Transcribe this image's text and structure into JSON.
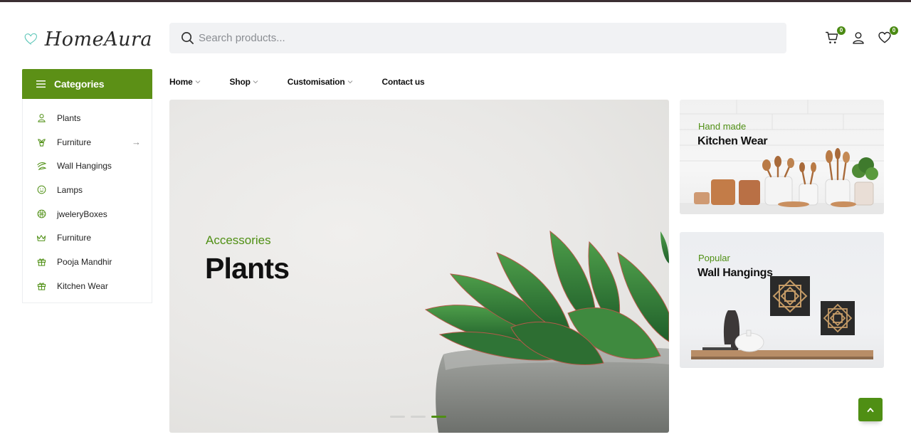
{
  "header": {
    "logo_text": "HomeAura",
    "search_placeholder": "Search products...",
    "cart_count": "0",
    "wishlist_count": "0"
  },
  "categories": {
    "title": "Categories",
    "items": [
      {
        "label": "Plants",
        "icon": "person-icon"
      },
      {
        "label": "Furniture",
        "icon": "plant-pot-icon",
        "has_submenu": true
      },
      {
        "label": "Wall Hangings",
        "icon": "leaf-icon"
      },
      {
        "label": "Lamps",
        "icon": "smile-icon"
      },
      {
        "label": "jweleryBoxes",
        "icon": "ball-icon"
      },
      {
        "label": "Furniture",
        "icon": "crown-icon"
      },
      {
        "label": "Pooja Mandhir",
        "icon": "gift-icon"
      },
      {
        "label": "Kitchen Wear",
        "icon": "gift-icon"
      }
    ]
  },
  "nav": {
    "items": [
      {
        "label": "Home",
        "dropdown": true
      },
      {
        "label": "Shop",
        "dropdown": true
      },
      {
        "label": "Customisation",
        "dropdown": true
      },
      {
        "label": "Contact us",
        "dropdown": false
      }
    ]
  },
  "hero": {
    "subtitle": "Accessories",
    "title": "Plants",
    "slides": 3,
    "active_slide": 3
  },
  "banners": [
    {
      "subtitle": "Hand made",
      "title": "Kitchen Wear"
    },
    {
      "subtitle": "Popular",
      "title": "Wall Hangings"
    }
  ],
  "colors": {
    "accent": "#5c9016",
    "accent_text": "#4f8f14",
    "top_line": "#3b2f33",
    "search_bg": "#f1f2f4"
  }
}
